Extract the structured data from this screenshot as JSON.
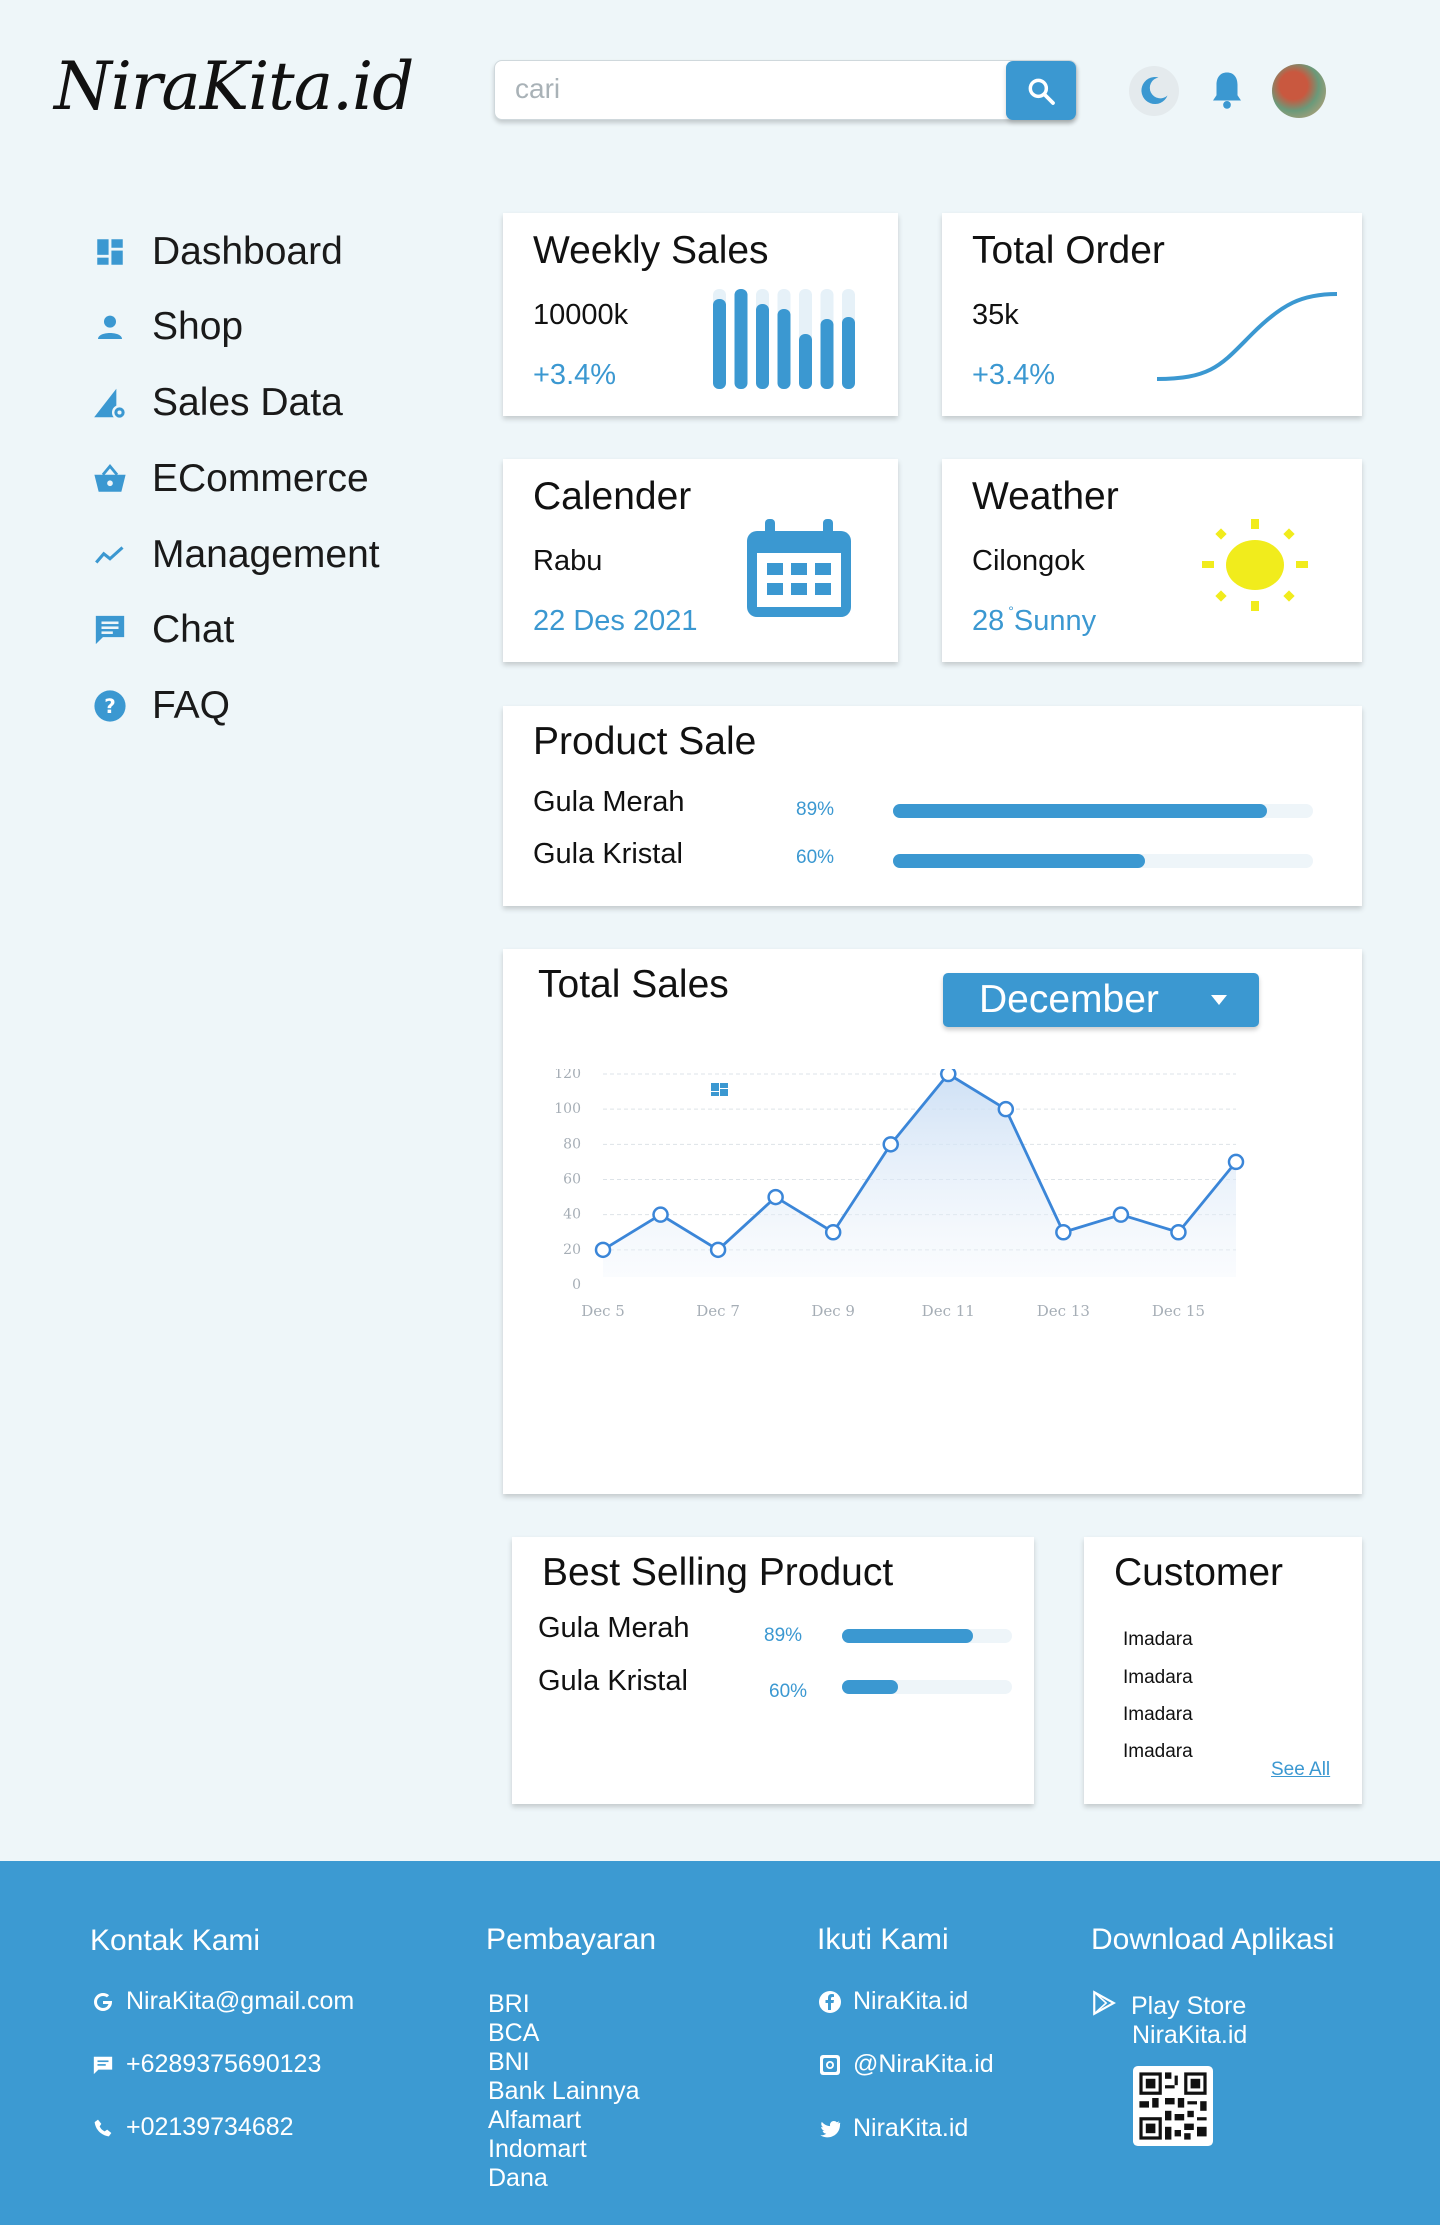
{
  "header": {
    "logo": "NiraKita.id",
    "search_placeholder": "cari"
  },
  "sidebar": {
    "items": [
      {
        "label": "Dashboard",
        "icon": "dashboard-icon"
      },
      {
        "label": "Shop",
        "icon": "person-icon"
      },
      {
        "label": "Sales Data",
        "icon": "sales-data-icon"
      },
      {
        "label": "ECommerce",
        "icon": "basket-icon"
      },
      {
        "label": "Management",
        "icon": "trend-icon"
      },
      {
        "label": "Chat",
        "icon": "chat-icon"
      },
      {
        "label": "FAQ",
        "icon": "help-icon"
      }
    ]
  },
  "weekly_sales": {
    "title": "Weekly Sales",
    "value": "10000k",
    "change": "+3.4%",
    "bars": [
      0.9,
      1.0,
      0.85,
      0.8,
      0.55,
      0.7,
      0.72
    ]
  },
  "total_order": {
    "title": "Total Order",
    "value": "35k",
    "change": "+3.4%"
  },
  "calendar": {
    "title": "Calender",
    "day": "Rabu",
    "date": "22 Des 2021"
  },
  "weather": {
    "title": "Weather",
    "location": "Cilongok",
    "temp": "28",
    "degree": "°",
    "condition": "Sunny"
  },
  "product_sale": {
    "title": "Product Sale",
    "items": [
      {
        "name": "Gula Merah",
        "percent_label": "89%",
        "percent": 89
      },
      {
        "name": "Gula Kristal",
        "percent_label": "60%",
        "percent": 60
      }
    ]
  },
  "total_sales": {
    "title": "Total Sales",
    "month": "December"
  },
  "chart_data": {
    "type": "line",
    "title": "",
    "xlabel": "",
    "ylabel": "",
    "x": [
      "Dec 5",
      "Dec 6",
      "Dec 7",
      "Dec 8",
      "Dec 9",
      "Dec 10",
      "Dec 11",
      "Dec 12",
      "Dec 13",
      "Dec 14",
      "Dec 15",
      "Dec 16"
    ],
    "x_tick_labels": [
      "Dec 5",
      "Dec 7",
      "Dec 9",
      "Dec 11",
      "Dec 13",
      "Dec 15"
    ],
    "y": [
      20,
      40,
      20,
      50,
      30,
      80,
      120,
      100,
      30,
      40,
      30,
      70
    ],
    "ylim": [
      0,
      120
    ],
    "y_ticks": [
      0,
      20,
      40,
      60,
      80,
      100,
      120
    ],
    "grid": true,
    "color": "#3b86d8"
  },
  "best_selling": {
    "title": "Best Selling Product",
    "items": [
      {
        "name": "Gula Merah",
        "percent_label": "89%",
        "percent": 77
      },
      {
        "name": "Gula Kristal",
        "percent_label": "60%",
        "percent": 33
      }
    ]
  },
  "customer": {
    "title": "Customer",
    "names": [
      "Imadara",
      "Imadara",
      "Imadara",
      "Imadara"
    ],
    "see_all": "See All"
  },
  "footer": {
    "contact": {
      "heading": "Kontak Kami",
      "email": "NiraKita@gmail.com",
      "phone1": "+6289375690123",
      "phone2": "+02139734682"
    },
    "payment": {
      "heading": "Pembayaran",
      "methods": [
        "BRI",
        "BCA",
        "BNI",
        "Bank Lainnya",
        "Alfamart",
        "Indomart",
        "Dana"
      ]
    },
    "follow": {
      "heading": "Ikuti Kami",
      "facebook": "NiraKita.id",
      "instagram": "@NiraKita.id",
      "twitter": "NiraKita.id"
    },
    "download": {
      "heading": "Download Aplikasi",
      "store": "Play Store",
      "app": "NiraKita.id"
    }
  },
  "colors": {
    "accent": "#3b98d1",
    "background": "#eef6f9",
    "sun": "#f1ec1c"
  }
}
